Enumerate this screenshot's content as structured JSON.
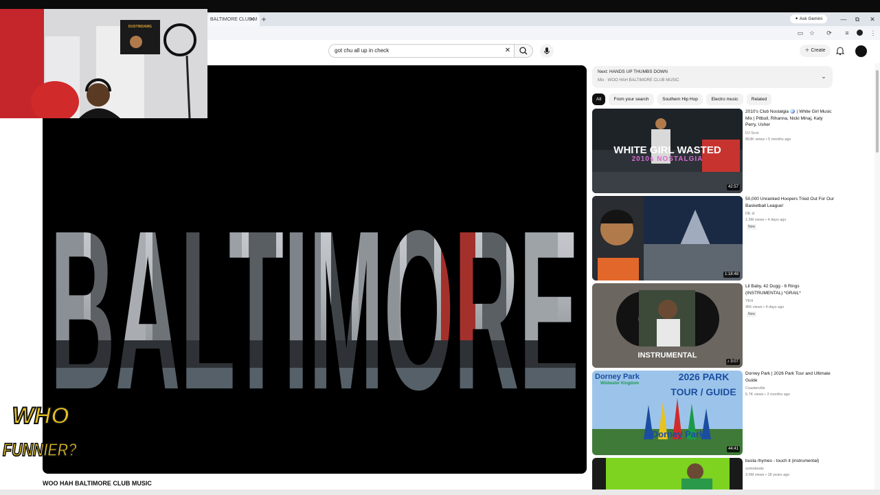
{
  "browser": {
    "tab_title": "BALTIMORE CLUB M",
    "tab_close": "✕",
    "new_tab": "+",
    "ask_gemini": "Ask Gemini",
    "window_controls": [
      "—",
      "⧉",
      "✕"
    ]
  },
  "youtube_header": {
    "search_value": "got chu all up in check",
    "clear_icon": "✕",
    "create_label": "Create"
  },
  "player": {
    "video_text": "BALTIMORE"
  },
  "video": {
    "title": "WOO HAH BALTIMORE CLUB MUSIC"
  },
  "webcam": {
    "poster_text": "DUSTINDAWG"
  },
  "logo": {
    "line1": "WHO",
    "line2": "FUNNIER?"
  },
  "up_next": {
    "title": "Next: HANDS UP THUMBS DOWN",
    "subtitle": "Mix · WOO HAH BALTIMORE CLUB MUSIC",
    "chevron": "⌄"
  },
  "chips": [
    "All",
    "From your search",
    "Southern Hip Hop",
    "Electro music",
    "Related"
  ],
  "recommendations": [
    {
      "title": "2010's Club Nostalgia 🪩 | White Girl Music Mix | Pitbull, Rihanna, Nicki Minaj, Katy Perry, Usher",
      "channel": "DJ Scot",
      "meta": "853K views • 5 months ago",
      "duration": "42:57",
      "thumb_text1": "WHITE GIRL WASTED",
      "thumb_text2": "2010s NOSTALGIA",
      "is_new": false
    },
    {
      "title": "50,000 Unranked Hoopers Tried Out For Our Basketball League!",
      "channel": "DE ⊘",
      "meta": "1.5M views • 4 days ago",
      "duration": "1:18:48",
      "is_new": true
    },
    {
      "title": "Lil Baby, 42 Dugg - 6 Rings (INSTRUMENTAL) *GRAIL*",
      "channel": "YEH",
      "meta": "456 views • 4 days ago",
      "duration": "♪ 3:07",
      "thumb_text1": "INSTRUMENTAL",
      "is_new": true
    },
    {
      "title": "Dorney Park | 2026 Park Tour and Ultimate Guide",
      "channel": "Coasterville",
      "meta": "5.7K views • 2 months ago",
      "duration": "44:41",
      "thumb_text1": "Dorney Park",
      "thumb_text2": "Wildwater Kingdom",
      "thumb_text3": "2026 PARK",
      "thumb_text4": "TOUR / GUIDE",
      "thumb_text5": "Dorney Park",
      "is_new": false
    },
    {
      "title": "busta rhymes - touch it (instrumental)",
      "channel": "somebeats",
      "meta": "3.5M views • 18 years ago",
      "duration": "",
      "is_new": false
    }
  ],
  "new_badge": "New"
}
